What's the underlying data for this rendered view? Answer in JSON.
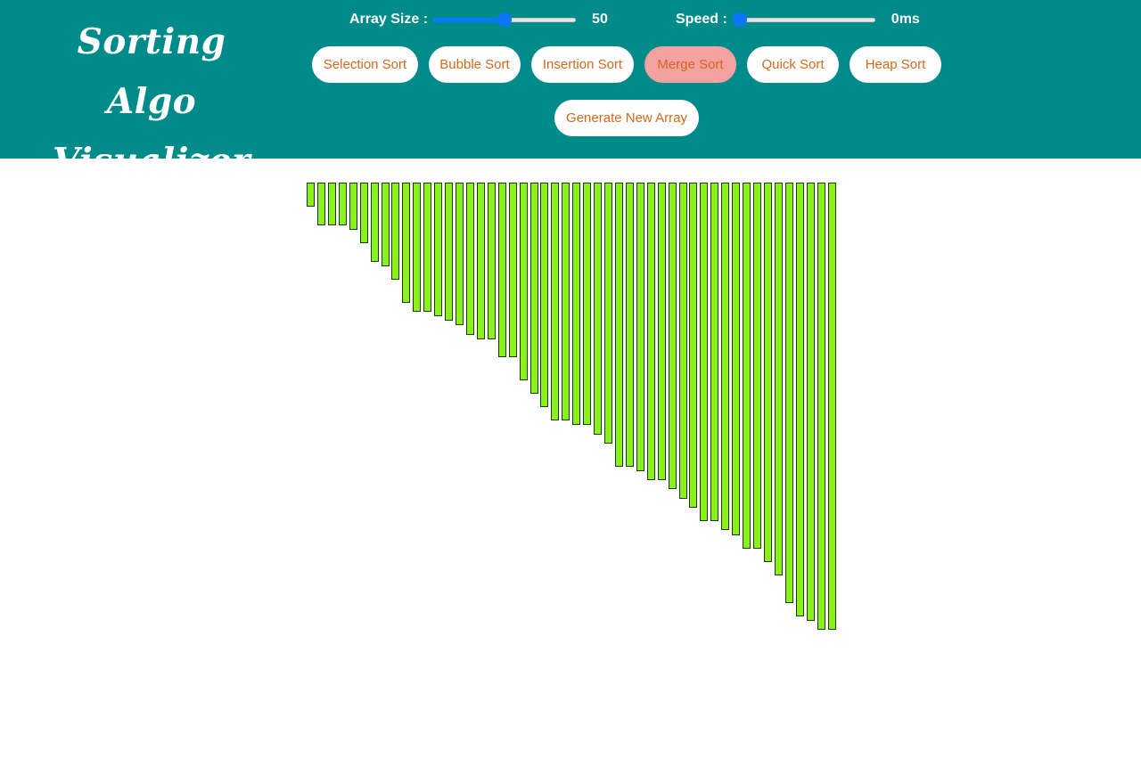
{
  "app": {
    "title_line1": "Sorting Algo",
    "title_line2": "Visualizer"
  },
  "controls": {
    "array_size": {
      "label": "Array Size :",
      "value_text": "50",
      "fraction": 0.5
    },
    "speed": {
      "label": "Speed :",
      "value_text": "0ms",
      "fraction": 0.0
    }
  },
  "algorithms": {
    "selection": "Selection Sort",
    "bubble": "Bubble Sort",
    "insertion": "Insertion Sort",
    "merge": "Merge Sort",
    "quick": "Quick Sort",
    "heap": "Heap Sort",
    "active": "merge"
  },
  "actions": {
    "generate": "Generate New Array"
  },
  "colors": {
    "header_bg": "#008b8b",
    "bar_fill": "#8cf01c",
    "active_button": "#f4a1a1",
    "button_text": "#d2691e",
    "slider_accent": "#0a75ff"
  },
  "array": {
    "values": [
      27,
      48,
      48,
      48,
      53,
      68,
      89,
      94,
      109,
      135,
      145,
      145,
      150,
      155,
      160,
      171,
      176,
      176,
      196,
      196,
      222,
      237,
      252,
      267,
      267,
      272,
      272,
      283,
      293,
      319,
      319,
      324,
      334,
      334,
      344,
      355,
      365,
      380,
      380,
      390,
      396,
      411,
      411,
      426,
      441,
      472,
      487,
      492,
      502,
      502
    ]
  }
}
